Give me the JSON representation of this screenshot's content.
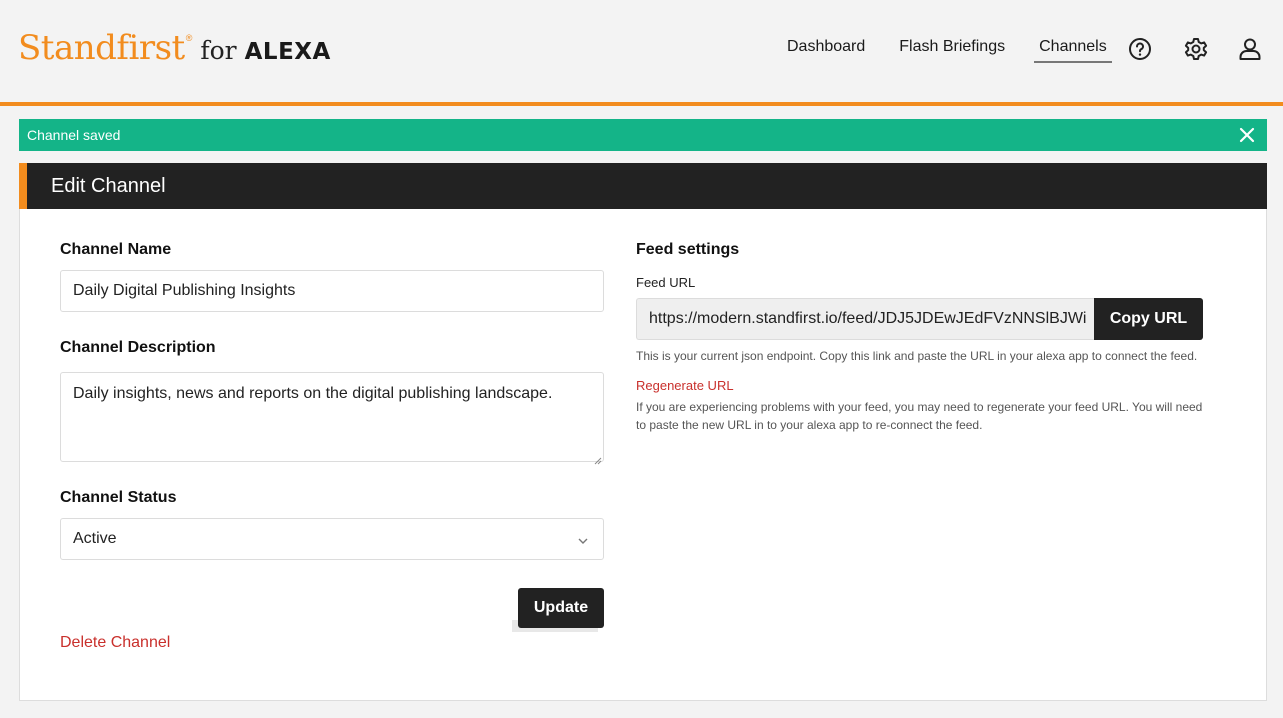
{
  "brand": {
    "name": "Standfirst",
    "reg_mark": "®",
    "for_text": "for",
    "product": "ALEXA",
    "accent_color": "#f28c1e"
  },
  "nav": {
    "links": [
      {
        "label": "Dashboard",
        "active": false
      },
      {
        "label": "Flash Briefings",
        "active": false
      },
      {
        "label": "Channels",
        "active": true
      }
    ],
    "icons": [
      "help-icon",
      "gear-icon",
      "user-icon"
    ]
  },
  "alert": {
    "message": "Channel saved",
    "color": "#14b488",
    "close_icon": "close-icon"
  },
  "panel": {
    "title": "Edit Channel"
  },
  "form": {
    "name_label": "Channel Name",
    "name_value": "Daily Digital Publishing Insights",
    "description_label": "Channel Description",
    "description_value": "Daily insights, news and reports on the digital publishing landscape.",
    "status_label": "Channel Status",
    "status_value": "Active",
    "update_button": "Update",
    "delete_link": "Delete Channel"
  },
  "feed": {
    "heading": "Feed settings",
    "url_label": "Feed URL",
    "url_value": "https://modern.standfirst.io/feed/JDJ5JDEwJEdFVzNNSlBJWi",
    "copy_button": "Copy URL",
    "help_text": "This is your current json endpoint. Copy this link and paste the URL in your alexa app to connect the feed.",
    "regenerate_link": "Regenerate URL",
    "regenerate_help_line1": "If you are experiencing problems with your feed, you may need to regenerate your feed URL. You will need",
    "regenerate_help_line2": "to paste the new URL in to your alexa app to re-connect the feed."
  }
}
